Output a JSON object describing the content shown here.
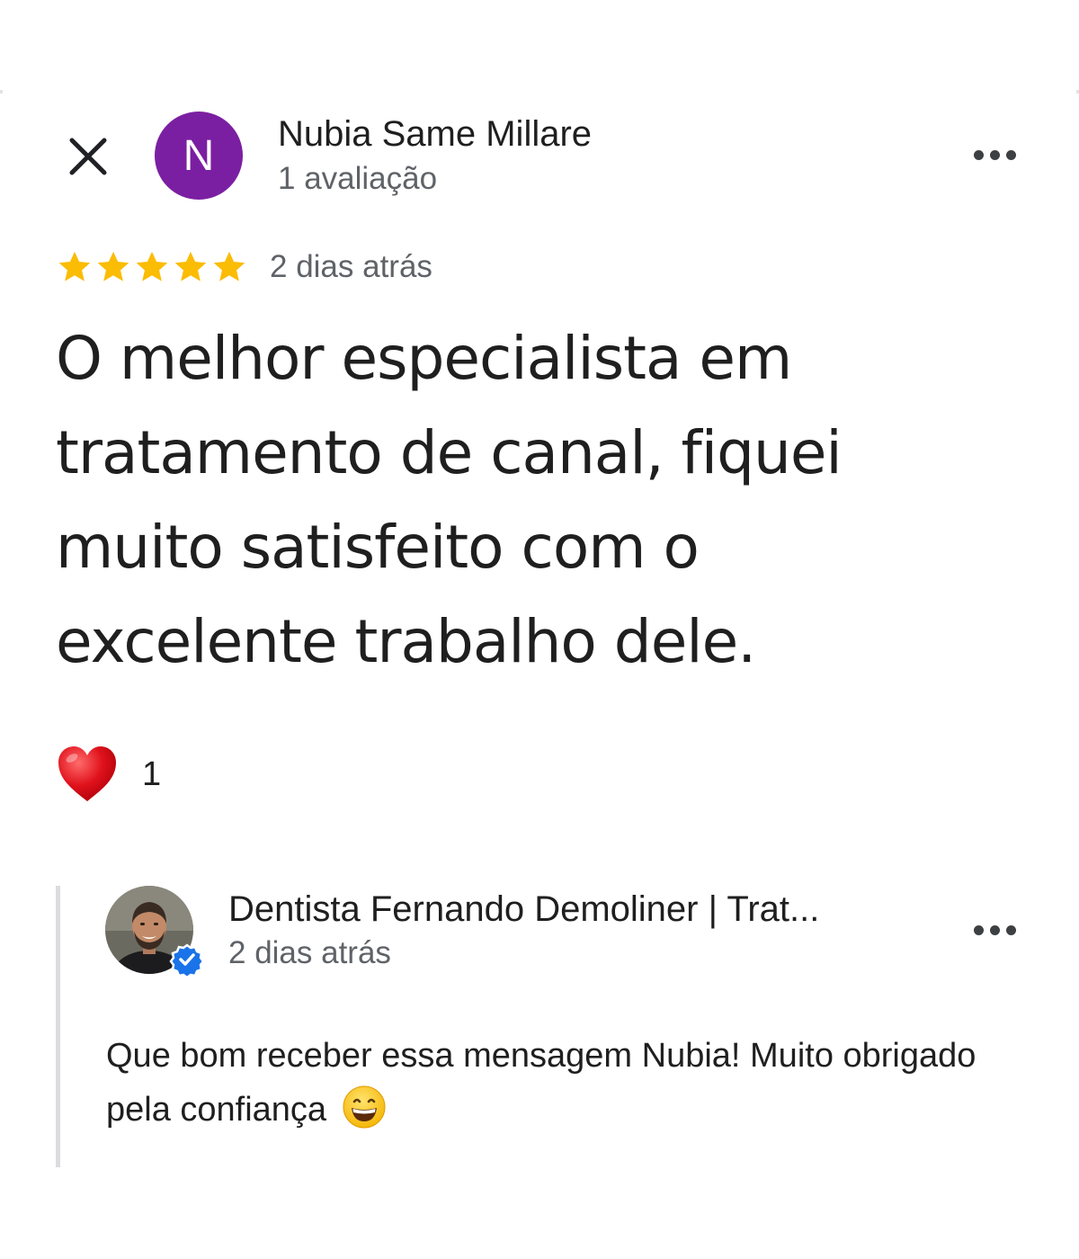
{
  "header": {
    "close_icon": "close-icon",
    "more_icon": "more-horizontal-icon"
  },
  "reviewer": {
    "initial": "N",
    "avatar_color": "#7b1fa2",
    "name": "Nubia Same Millare",
    "review_count": "1 avaliação"
  },
  "review": {
    "rating": 5,
    "max_rating": 5,
    "star_color": "#fbbc04",
    "date": "2 dias atrás",
    "text": "O melhor especialista em tratamento de canal, fiquei muito satisfeito com o excelente trabalho dele."
  },
  "reaction": {
    "icon": "heart-icon",
    "count": "1"
  },
  "reply": {
    "owner_name": "Dentista Fernando Demoliner | Trat...",
    "verified_icon": "verified-badge-icon",
    "date": "2 dias atrás",
    "text": "Que bom receber essa mensagem Nubia! Muito obrigado pela confiança",
    "emoji": "grinning-face-icon"
  }
}
